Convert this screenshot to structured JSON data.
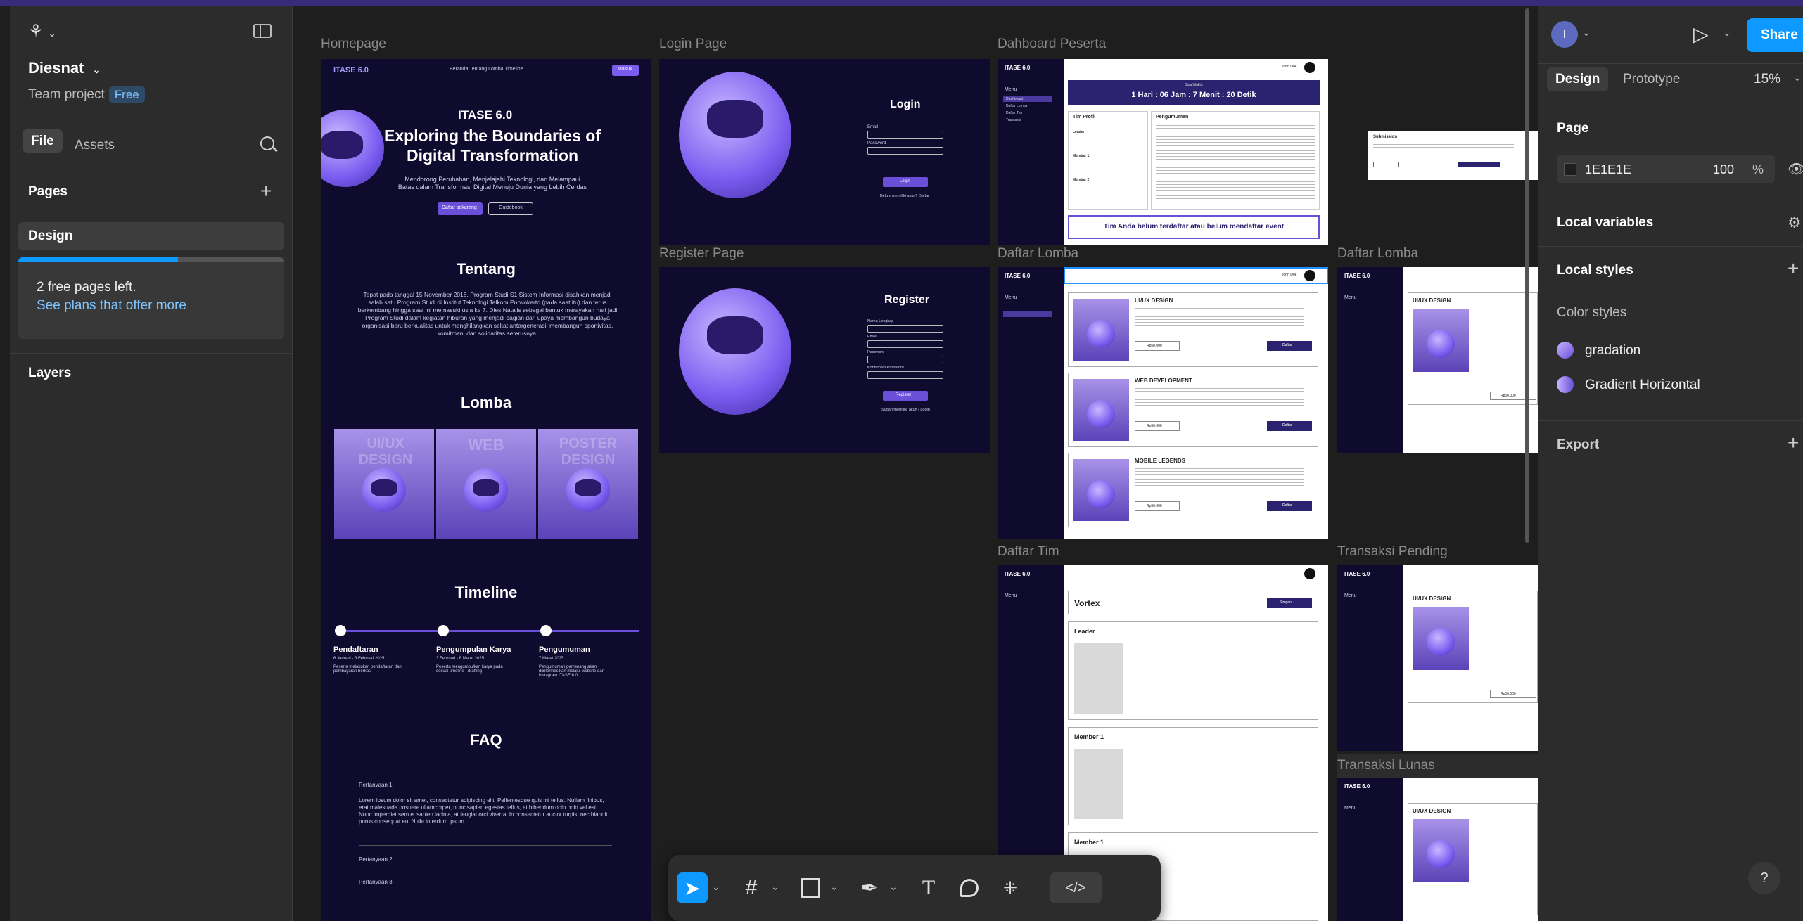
{
  "file": {
    "name": "Diesnat",
    "team": "Team project",
    "plan_badge": "Free"
  },
  "left_tabs": {
    "file": "File",
    "assets": "Assets"
  },
  "pages": {
    "heading": "Pages",
    "items": [
      "Design"
    ],
    "notice_title": "2 free pages left.",
    "notice_link": "See plans that offer more",
    "notice_progress": 0.6
  },
  "layers": {
    "heading": "Layers"
  },
  "right": {
    "avatar_letter": "I",
    "share": "Share",
    "tabs": [
      "Design",
      "Prototype"
    ],
    "zoom": "15%",
    "page_heading": "Page",
    "page_color": "1E1E1E",
    "page_opacity": "100",
    "percent": "%",
    "local_variables": "Local variables",
    "local_styles": "Local styles",
    "color_styles_heading": "Color styles",
    "color_styles": [
      "gradation",
      "Gradient Horizontal"
    ],
    "export": "Export"
  },
  "frames": {
    "homepage": "Homepage",
    "login": "Login Page",
    "dashboard": "Dahboard Peserta",
    "register": "Register Page",
    "daftar_lomba_1": "Daftar Lomba",
    "daftar_lomba_2": "Daftar Lomba",
    "daftar_tim": "Daftar Tim",
    "transaksi_pending": "Transaksi Pending",
    "transaksi_lunas": "Transaksi Lunas"
  },
  "homepage": {
    "brand": "ITASE 6.0",
    "nav": "Beranda   Tentang   Lomba   Timeline",
    "masuk": "Masuk",
    "event": "ITASE 6.0",
    "hero_title_1": "Exploring the Boundaries of",
    "hero_title_2": "Digital Transformation",
    "hero_sub_1": "Mendorong Perubahan, Menjelajahi Teknologi, dan Melampaui",
    "hero_sub_2": "Batas dalam Transformasi Digital Menuju Dunia yang Lebih Cerdas",
    "btn_daftar": "Daftar sekarang",
    "btn_guidebook": "Guidebook",
    "tentang": "Tentang",
    "tentang_text": "Tepat pada tanggal 15 November 2016, Program Studi S1 Sistem Informasi disahkan menjadi salah satu Program Studi di Institut Teknologi Telkom Purwokerto (pada saat itu) dan terus berkembang hingga saat ini memasuki usia ke 7. Dies Natalis sebagai bentuk merayakan hari jadi Program Studi dalam kegiatan hiburan yang menjadi bagian dari upaya membangun budaya organisasi baru berkualitas untuk menghilangkan sekat antargenerasi, membangun sportivitas, komitmen, dan solidaritas seterusnya.",
    "lomba": "Lomba",
    "lomba_cards": [
      "UI/UX DESIGN",
      "WEB",
      "POSTER DESIGN"
    ],
    "timeline": "Timeline",
    "timeline_items": [
      {
        "title": "Pendaftaran",
        "date": "6 Januari - 3 Februari 2025",
        "desc": "Peserta melakukan pendaftaran dan pembayaran berkas"
      },
      {
        "title": "Pengumpulan Karya",
        "date": "3 Februari - 8 Maret 2025",
        "desc": "Peserta mengumpulkan karya pada sesuai timeline - drafting"
      },
      {
        "title": "Pengumuman",
        "date": "7 Maret 2025",
        "desc": "Pengumuman pemenang akan diinformasikan melalui website dan instagram ITASE 6.0"
      }
    ],
    "faq": "FAQ",
    "faq_items": [
      "Pertanyaan 1",
      "Pertanyaan 2",
      "Pertanyaan 3"
    ],
    "faq_answer": "Lorem ipsum dolor sit amet, consectetur adipiscing elit. Pellentesque quis mi tellus. Nullam finibus, erat malesuada posuere ullamcorper, nunc sapien egestas tellus, et bibendum odio odio vel est. Nunc imperdiet sem et sapien lacinia, at feugiat orci viverra. In consectetur auctor turpis, nec blandit purus consequat eu. Nulla interdum ipsum."
  },
  "login": {
    "title": "Login",
    "email": "Email",
    "password": "Password",
    "button": "Login",
    "footer": "Belum memiliki akun? Daftar"
  },
  "register": {
    "title": "Register",
    "fields": [
      "Nama Lengkap",
      "Email",
      "Password",
      "Konfirmasi Password"
    ],
    "button": "Register",
    "footer": "Sudah memiliki akun? Login"
  },
  "dashboard": {
    "brand": "ITASE 6.0",
    "menu": "Menu",
    "menu_items": [
      "Dashboard",
      "Daftar Lomba",
      "Daftar Tim",
      "Transaksi"
    ],
    "user": "John Doe",
    "countdown_label": "Sisa Waktu",
    "countdown": "1 Hari : 06 Jam : 7 Menit : 20 Detik",
    "tim_profil": "Tim Profil",
    "pengumuman": "Pengumuman",
    "leader": "Leader",
    "member1": "Member 1",
    "member2": "Member 2",
    "notice": "Tim Anda belum terdaftar atau belum mendaftar event",
    "submission": "Submission"
  },
  "lomba_list": [
    {
      "name": "UI/UX DESIGN",
      "price": "Rp50.000",
      "button": "Daftar"
    },
    {
      "name": "WEB DEVELOPMENT",
      "price": "Rp50.000",
      "button": "Daftar"
    },
    {
      "name": "MOBILE LEGENDS",
      "price": "Rp50.000",
      "button": "Daftar"
    }
  ],
  "daftar_tim": {
    "team": "Vortex",
    "save": "Simpan",
    "leader": "Leader",
    "member1": "Member 1",
    "member1b": "Member 1"
  },
  "mini_detail": {
    "title": "UI/UX DESIGN",
    "price": "Rp50.000"
  },
  "toolbar": {
    "tools": [
      "move-tool",
      "frame-tool",
      "shape-tool",
      "pen-tool",
      "text-tool",
      "comment-tool",
      "actions-tool",
      "dev-mode"
    ]
  },
  "help": "?"
}
